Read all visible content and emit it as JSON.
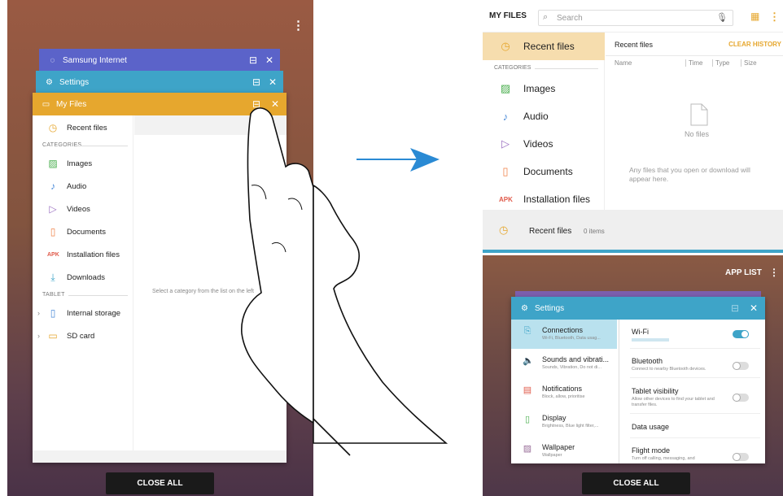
{
  "left": {
    "cards": [
      {
        "title": "Samsung Internet",
        "color": "#5b63c9"
      },
      {
        "title": "Settings",
        "color": "#3ea4c8"
      },
      {
        "title": "My Files",
        "color": "#e6a72e"
      }
    ],
    "sidebar": {
      "recent": "Recent files",
      "categories_label": "CATEGORIES",
      "categories": [
        "Images",
        "Audio",
        "Videos",
        "Documents",
        "Installation files",
        "Downloads"
      ],
      "apk_badge": "APK",
      "tablet_label": "TABLET",
      "storage": [
        "Internal storage",
        "SD card"
      ]
    },
    "hint": "Select a category from the list on the left",
    "close_all": "CLOSE ALL"
  },
  "right": {
    "app_title": "MY FILES",
    "search_placeholder": "Search",
    "sidebar": {
      "recent": "Recent files",
      "categories_label": "CATEGORIES",
      "categories": [
        "Images",
        "Audio",
        "Videos",
        "Documents",
        "Installation files"
      ],
      "apk_badge": "APK"
    },
    "content": {
      "heading": "Recent files",
      "clear": "CLEAR HISTORY",
      "columns": [
        "Name",
        "Time",
        "Type",
        "Size"
      ],
      "empty": "No files",
      "empty_sub": "Any files that you open or download will appear here."
    },
    "footer": {
      "label": "Recent files",
      "count": "0 items"
    },
    "app_list": "APP LIST",
    "settings_title": "Settings",
    "settings_left": [
      {
        "title": "Connections",
        "sub": "Wi-Fi, Bluetooth, Data usag..."
      },
      {
        "title": "Sounds and vibrati...",
        "sub": "Sounds, Vibration, Do not di..."
      },
      {
        "title": "Notifications",
        "sub": "Block, allow, prioritise"
      },
      {
        "title": "Display",
        "sub": "Brightness, Blue light filter,..."
      },
      {
        "title": "Wallpaper",
        "sub": "Wallpaper"
      }
    ],
    "settings_right": [
      {
        "title": "Wi-Fi",
        "sub": ""
      },
      {
        "title": "Bluetooth",
        "sub": "Connect to nearby Bluetooth devices."
      },
      {
        "title": "Tablet visibility",
        "sub": "Allow other devices to find your tablet and transfer files."
      },
      {
        "title": "Data usage",
        "sub": ""
      },
      {
        "title": "Flight mode",
        "sub": "Turn off calling, messaging, and"
      }
    ],
    "close_all": "CLOSE ALL"
  },
  "colors": {
    "accent_orange": "#e6a72e",
    "highlight": "#f6ddae",
    "settings_blue": "#3ea4c8",
    "arrow": "#2a8ad4"
  }
}
